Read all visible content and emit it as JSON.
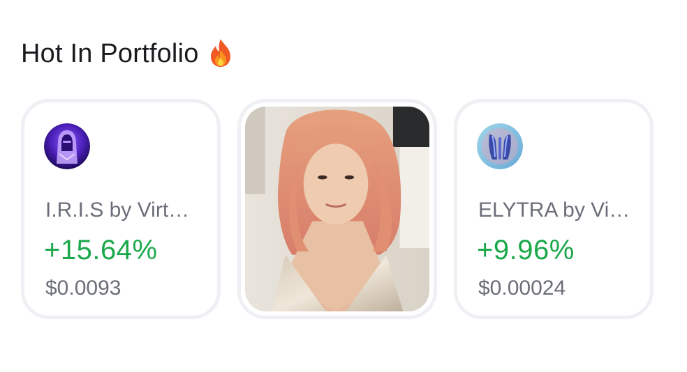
{
  "section": {
    "title": "Hot In Portfolio",
    "title_icon": "fire-icon"
  },
  "cards": [
    {
      "kind": "token",
      "avatar_icon": "iris-token-avatar",
      "name": "I.R.I.S by Virt…",
      "change": "+15.64%",
      "price": "$0.0093"
    },
    {
      "kind": "image",
      "image": "person-photo"
    },
    {
      "kind": "token",
      "avatar_icon": "elytra-token-avatar",
      "name": "ELYTRA by Vi…",
      "change": "+9.96%",
      "price": "$0.00024"
    }
  ],
  "colors": {
    "positive": "#1aa84a",
    "muted_text": "#6b6e78",
    "card_border": "#eef0f4"
  }
}
